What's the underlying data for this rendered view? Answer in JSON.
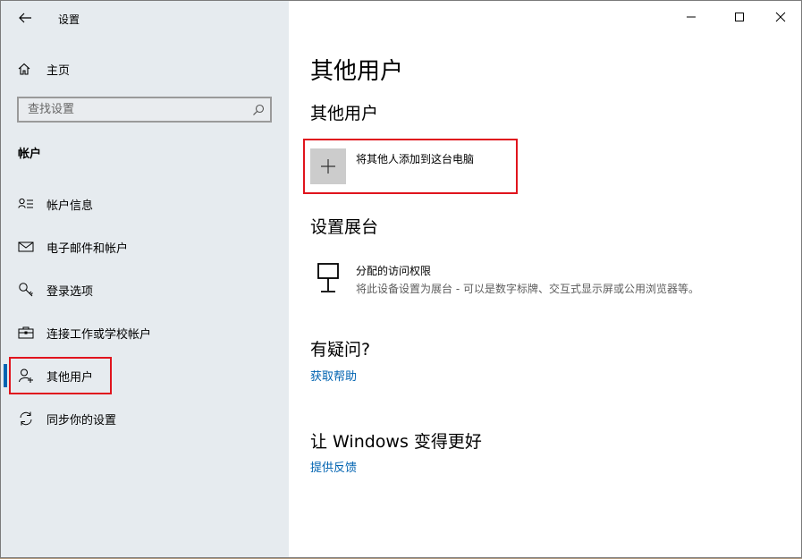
{
  "app": {
    "title": "设置"
  },
  "window_controls": {
    "minimize": "minimize-icon",
    "maximize": "maximize-icon",
    "close": "close-icon"
  },
  "sidebar": {
    "home": {
      "label": "主页",
      "icon": "home-icon"
    },
    "search": {
      "placeholder": "查找设置",
      "value": ""
    },
    "section": "帐户",
    "items": [
      {
        "label": "帐户信息",
        "icon": "account-info-icon",
        "active": false
      },
      {
        "label": "电子邮件和帐户",
        "icon": "mail-icon",
        "active": false
      },
      {
        "label": "登录选项",
        "icon": "key-icon",
        "active": false
      },
      {
        "label": "连接工作或学校帐户",
        "icon": "briefcase-icon",
        "active": false
      },
      {
        "label": "其他用户",
        "icon": "add-person-icon",
        "active": true
      },
      {
        "label": "同步你的设置",
        "icon": "sync-icon",
        "active": false
      }
    ]
  },
  "main": {
    "title": "其他用户",
    "other_users": {
      "heading": "其他用户",
      "add_button": {
        "label": "将其他人添加到这台电脑",
        "icon": "plus-icon"
      }
    },
    "kiosk": {
      "heading": "设置展台",
      "item": {
        "title": "分配的访问权限",
        "description": "将此设备设置为展台 - 可以是数字标牌、交互式显示屏或公用浏览器等。",
        "icon": "kiosk-icon"
      }
    },
    "help": {
      "heading": "有疑问?",
      "link": "获取帮助"
    },
    "feedback": {
      "heading": "让 Windows 变得更好",
      "link": "提供反馈"
    }
  },
  "colors": {
    "accent": "#0063b1",
    "sidebar_bg": "#e6ebef",
    "highlight": "#e0141d"
  }
}
